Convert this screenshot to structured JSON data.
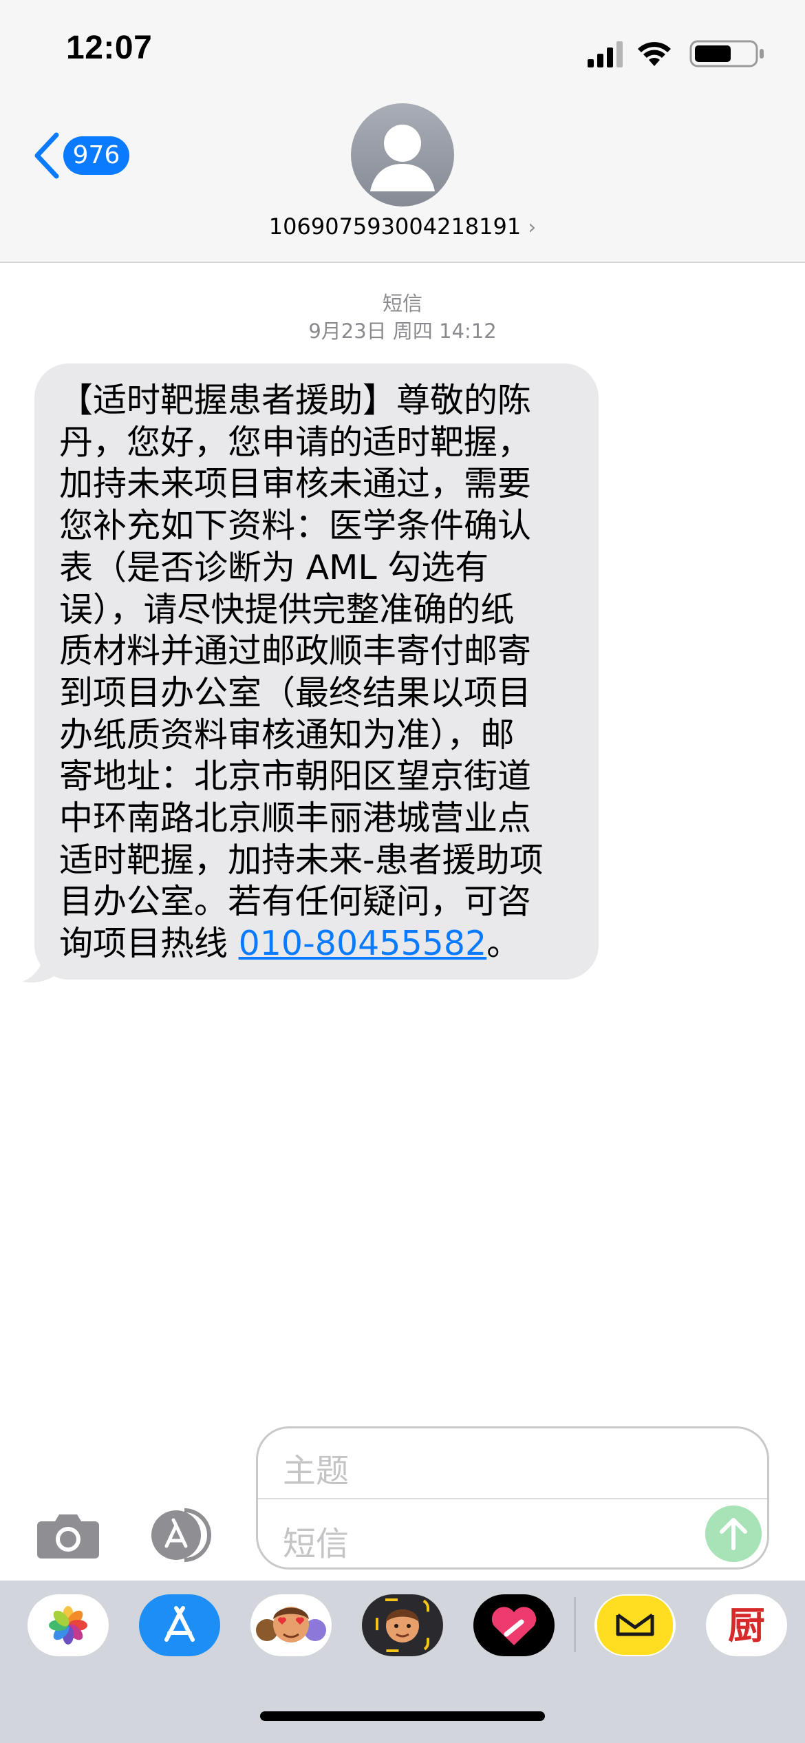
{
  "status_bar": {
    "time": "12:07"
  },
  "nav": {
    "back_count": "976",
    "contact_number": "106907593004218191",
    "chevron": "›"
  },
  "thread": {
    "service": "短信",
    "timestamp": "9月23日 周四 14:12"
  },
  "message": {
    "lines": [
      "【适时靶握患者援助】尊敬的陈",
      "丹，您好，您申请的适时靶握，",
      "加持未来项目审核未通过，需要",
      "您补充如下资料：医学条件确认",
      "表（是否诊断为 AML 勾选有",
      "误），请尽快提供完整准确的纸",
      "质材料并通过邮政顺丰寄付邮寄",
      "到项目办公室（最终结果以项目",
      "办纸质资料审核通知为准），邮",
      "寄地址：北京市朝阳区望京街道",
      "中环南路北京顺丰丽港城营业点",
      "适时靶握，加持未来-患者援助项",
      "目办公室。若有任何疑问，可咨"
    ],
    "last_prefix": "询项目热线 ",
    "phone_link": "010-80455582",
    "last_suffix": "。"
  },
  "compose": {
    "subject_placeholder": "主题",
    "body_placeholder": "短信"
  },
  "app_drawer": {
    "apps": [
      "photos-icon",
      "app-store-icon",
      "memoji-stickers-icon",
      "memoji-icon",
      "digital-touch-icon",
      "yellow-app-icon",
      "kitchen-app-icon"
    ],
    "kitchen_glyph": "厨"
  },
  "colors": {
    "accent": "#0a7aff",
    "bubble_gray": "#e9e9eb",
    "send_green": "#a7e3b6"
  }
}
